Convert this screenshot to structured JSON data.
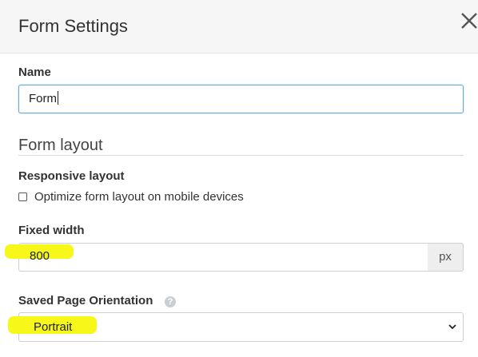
{
  "dialog": {
    "title": "Form Settings",
    "close_icon": "close-icon"
  },
  "name_field": {
    "label": "Name",
    "value": "Form"
  },
  "layout_section": {
    "title": "Form layout"
  },
  "responsive": {
    "label": "Responsive layout",
    "checkbox_label": "Optimize form layout on mobile devices",
    "checked": false
  },
  "fixed_width": {
    "label": "Fixed width",
    "value": "800",
    "unit": "px"
  },
  "orientation": {
    "label": "Saved Page Orientation",
    "help_icon": "question-icon",
    "help_glyph": "?",
    "selected": "Portrait"
  },
  "colors": {
    "highlight": "#f7f71a",
    "focus_border": "#69a9d8",
    "header_bg": "#f6f6f6"
  }
}
